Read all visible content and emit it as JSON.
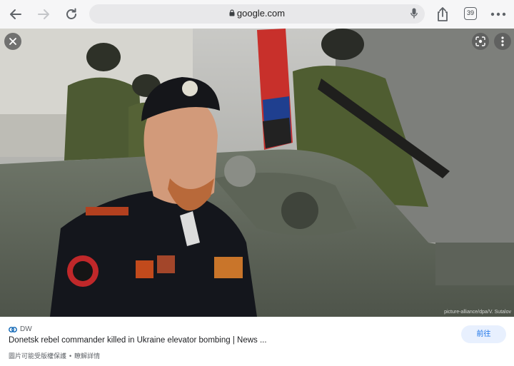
{
  "browser": {
    "url": "google.com",
    "tab_count": "39"
  },
  "image": {
    "watermark": "picture-alliance/dpa/V. Sutalov"
  },
  "result": {
    "source": "DW",
    "title": "Donetsk rebel commander killed in Ukraine elevator bombing | News ...",
    "notice": "圖片可能受版權保護",
    "learn_more": "瞭解詳情",
    "visit_label": "前往"
  },
  "colors": {
    "accent": "#1a73e8",
    "visit_bg": "#e8f0fe",
    "toolbar_bg": "#f6f6f7"
  }
}
